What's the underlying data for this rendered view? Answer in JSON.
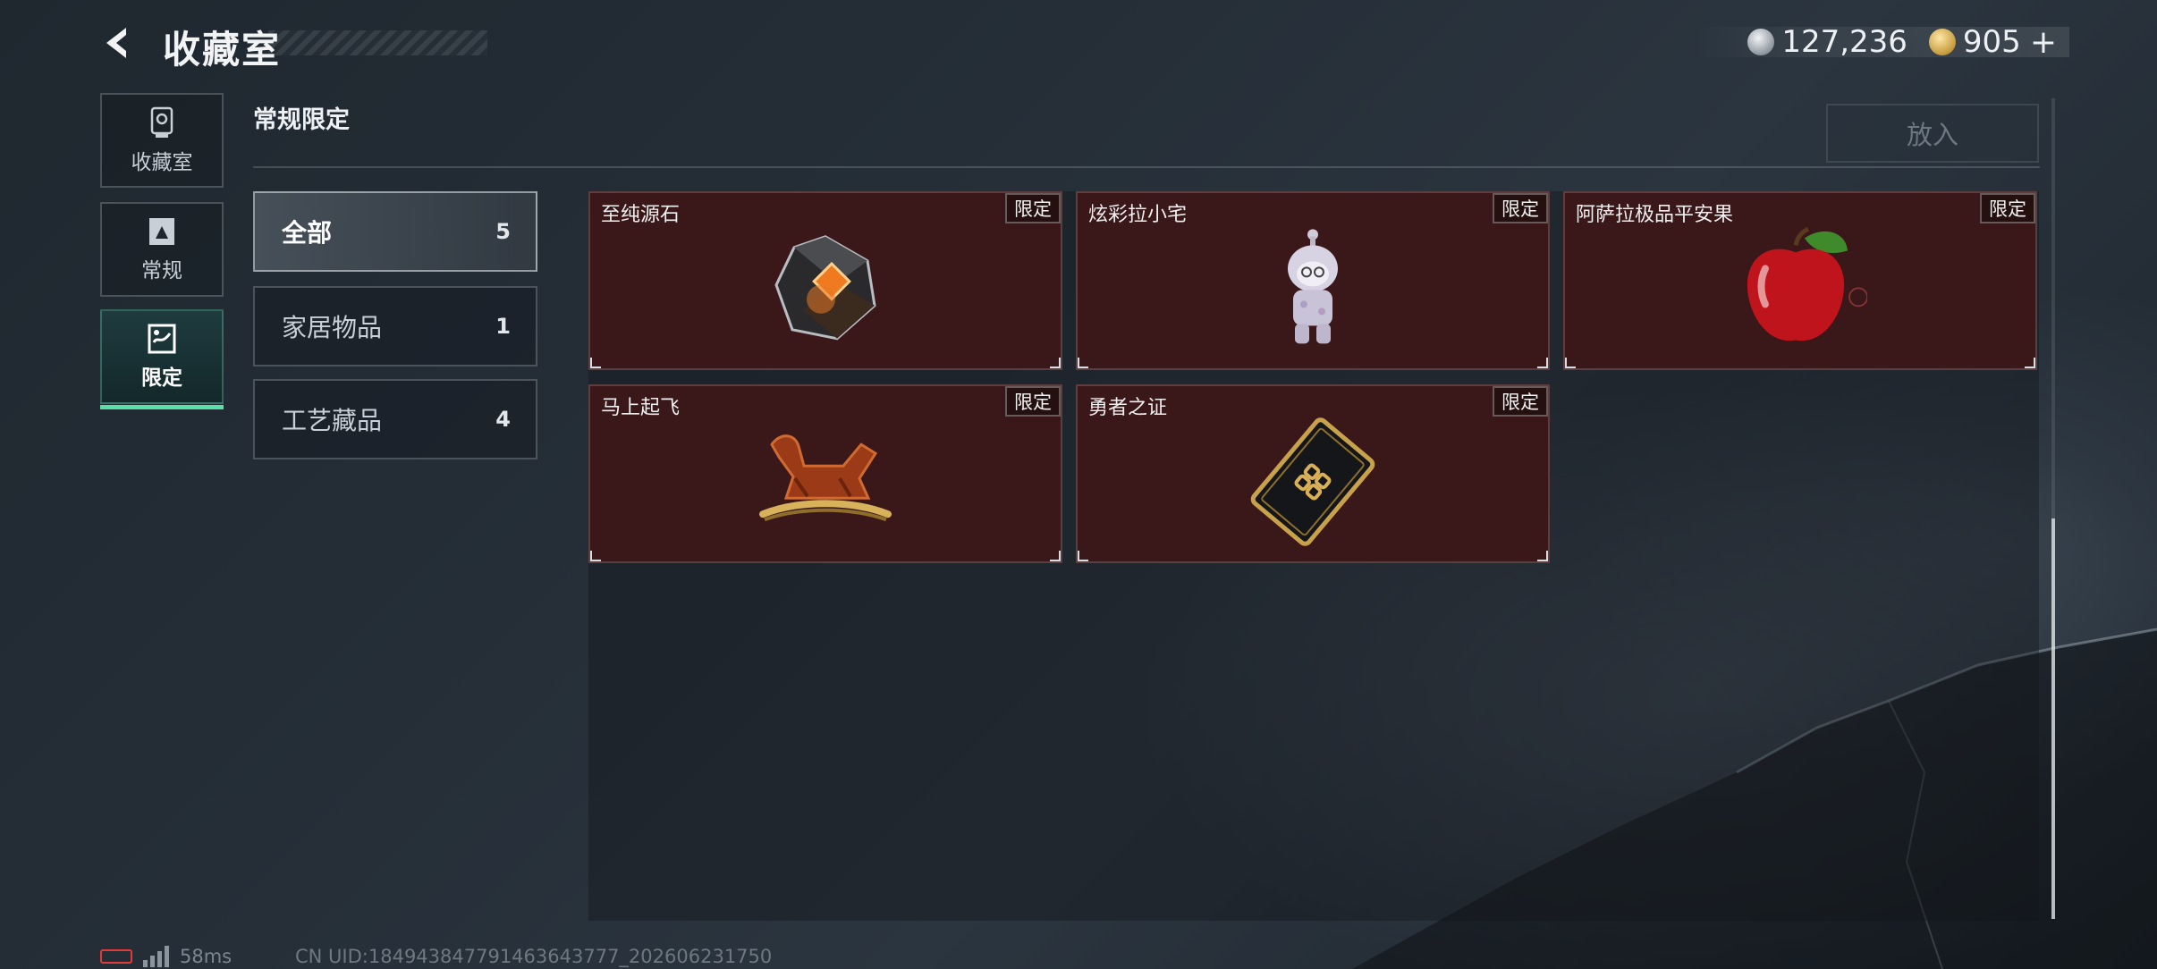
{
  "header": {
    "title": "收藏室",
    "currencies": [
      {
        "icon": "silver-coin-icon",
        "amount": "127,236"
      },
      {
        "icon": "gold-coin-icon",
        "amount": "905",
        "suffix": "+"
      }
    ]
  },
  "rail": {
    "items": [
      {
        "label": "收藏室",
        "icon": "trophy-icon",
        "active": false
      },
      {
        "label": "常规",
        "icon": "regular-frame-icon",
        "active": false
      },
      {
        "label": "限定",
        "icon": "limited-frame-icon",
        "active": true
      }
    ]
  },
  "section": {
    "title": "常规限定",
    "put_in_label": "放入"
  },
  "categories": [
    {
      "name": "全部",
      "count": "5",
      "active": true
    },
    {
      "name": "家居物品",
      "count": "1",
      "active": false
    },
    {
      "name": "工艺藏品",
      "count": "4",
      "active": false
    }
  ],
  "items": [
    {
      "name": "至纯源石",
      "tag": "限定",
      "icon": "crystal-stone-icon"
    },
    {
      "name": "炫彩拉小宅",
      "tag": "限定",
      "icon": "figurine-icon"
    },
    {
      "name": "阿萨拉极品平安果",
      "tag": "限定",
      "icon": "apple-icon"
    },
    {
      "name": "马上起飞",
      "tag": "限定",
      "icon": "rocking-horse-icon"
    },
    {
      "name": "勇者之证",
      "tag": "限定",
      "icon": "badge-card-icon"
    }
  ],
  "status": {
    "ping": "58ms",
    "uid": "CN UID:18494384779146364377​7_202606231750"
  },
  "colors": {
    "accent": "#59e0a7",
    "card_bg": "#3a1719"
  }
}
